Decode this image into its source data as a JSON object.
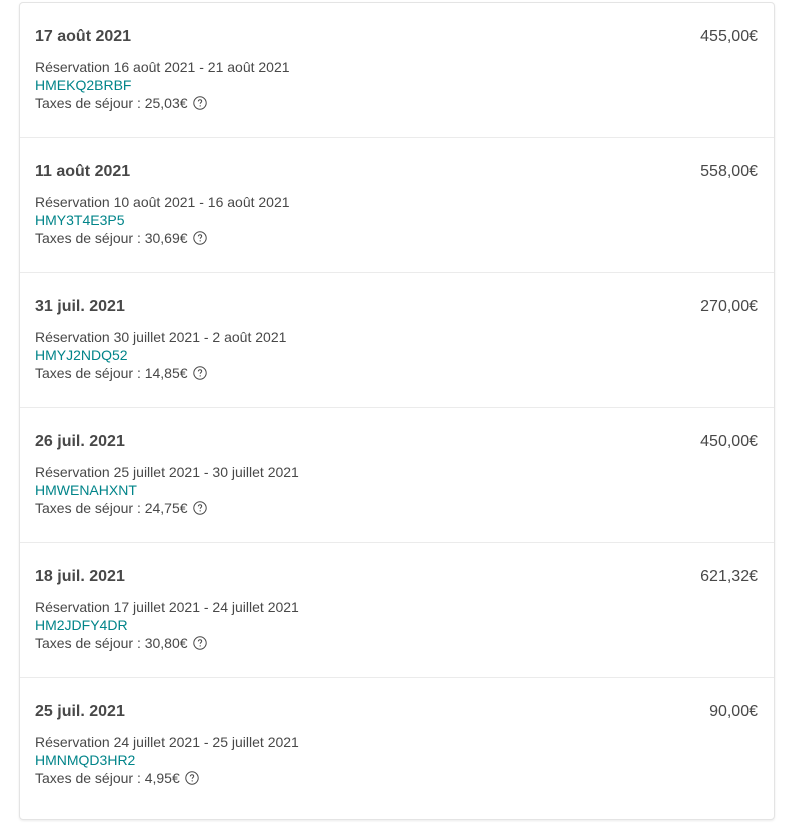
{
  "transactions": [
    {
      "date": "17 août 2021",
      "amount": "455,00€",
      "reservation": "Réservation 16 août 2021 - 21 août 2021",
      "code": "HMEKQ2BRBF",
      "tax": "Taxes de séjour : 25,03€"
    },
    {
      "date": "11 août 2021",
      "amount": "558,00€",
      "reservation": "Réservation 10 août 2021 - 16 août 2021",
      "code": "HMY3T4E3P5",
      "tax": "Taxes de séjour : 30,69€"
    },
    {
      "date": "31 juil. 2021",
      "amount": "270,00€",
      "reservation": "Réservation 30 juillet 2021 - 2 août 2021",
      "code": "HMYJ2NDQ52",
      "tax": "Taxes de séjour : 14,85€"
    },
    {
      "date": "26 juil. 2021",
      "amount": "450,00€",
      "reservation": "Réservation 25 juillet 2021 - 30 juillet 2021",
      "code": "HMWENAHXNT",
      "tax": "Taxes de séjour : 24,75€"
    },
    {
      "date": "18 juil. 2021",
      "amount": "621,32€",
      "reservation": "Réservation 17 juillet 2021 - 24 juillet 2021",
      "code": "HM2JDFY4DR",
      "tax": "Taxes de séjour : 30,80€"
    },
    {
      "date": "25 juil. 2021",
      "amount": "90,00€",
      "reservation": "Réservation 24 juillet 2021 - 25 juillet 2021",
      "code": "HMNMQD3HR2",
      "tax": "Taxes de séjour : 4,95€"
    }
  ],
  "colors": {
    "text": "#484848",
    "link": "#008489",
    "divider": "#ebebeb"
  },
  "icons": {
    "help": "question-circle-icon"
  }
}
